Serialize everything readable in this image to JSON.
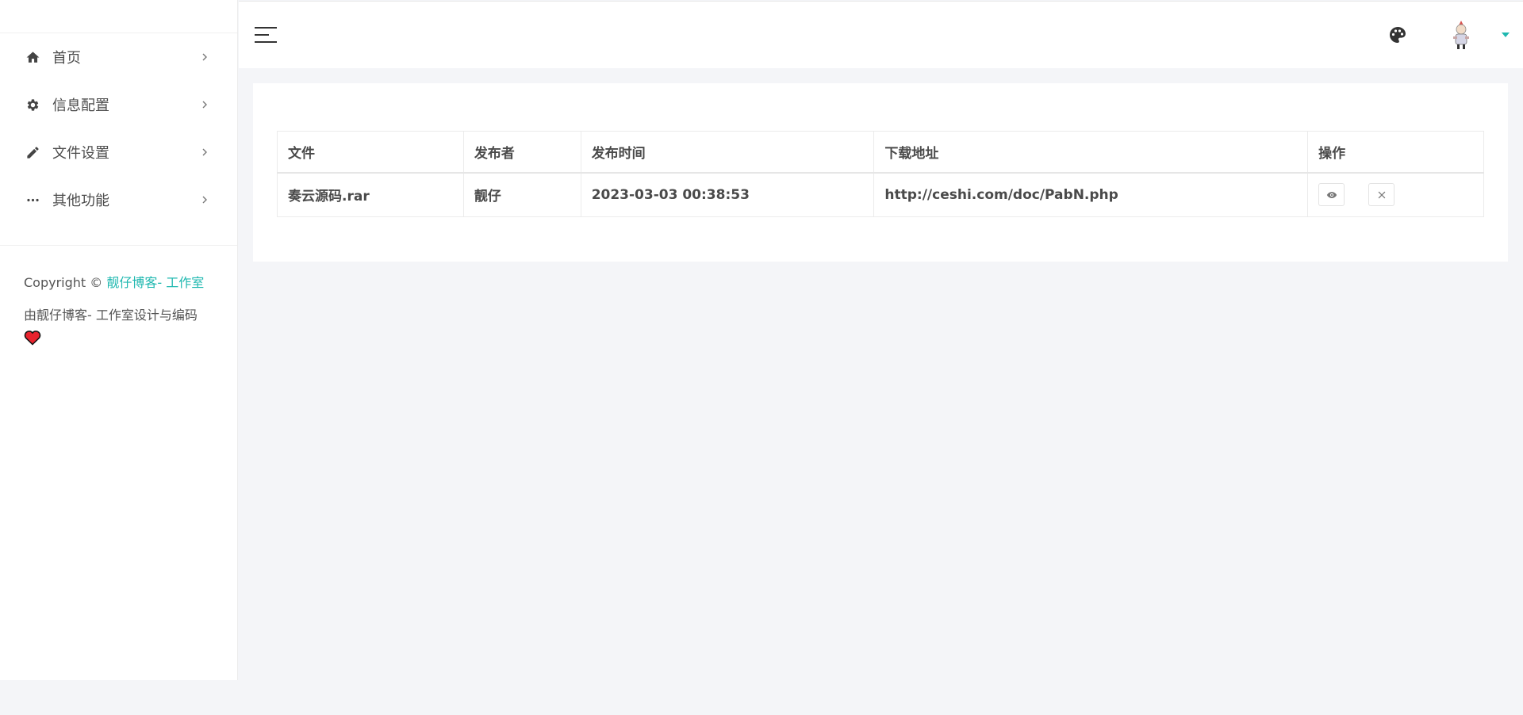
{
  "sidebar": {
    "items": [
      {
        "label": "首页",
        "icon": "home-icon"
      },
      {
        "label": "信息配置",
        "icon": "gear-icon"
      },
      {
        "label": "文件设置",
        "icon": "pencil-icon"
      },
      {
        "label": "其他功能",
        "icon": "more-dots-icon"
      }
    ],
    "copyright_prefix": "Copyright ©",
    "copyright_link": "靓仔博客- 工作室",
    "credit": "由靓仔博客- 工作室设计与编码"
  },
  "header": {
    "menu_icon": "hamburger-menu-icon",
    "theme_icon": "palette-icon",
    "user_icon": "avatar",
    "dropdown_icon": "caret-down-icon"
  },
  "table": {
    "columns": [
      "文件",
      "发布者",
      "发布时间",
      "下载地址",
      "操作"
    ],
    "rows": [
      {
        "file": "奏云源码.rar",
        "publisher": "靓仔",
        "time": "2023-03-03 00:38:53",
        "url": "http://ceshi.com/doc/PabN.php",
        "actions": [
          "eye-icon",
          "close-icon"
        ]
      }
    ]
  },
  "colors": {
    "accent": "#20b8b0",
    "background": "#f4f5f8",
    "card": "#ffffff",
    "text": "#4a4a4a",
    "heart": "#e8232e"
  }
}
